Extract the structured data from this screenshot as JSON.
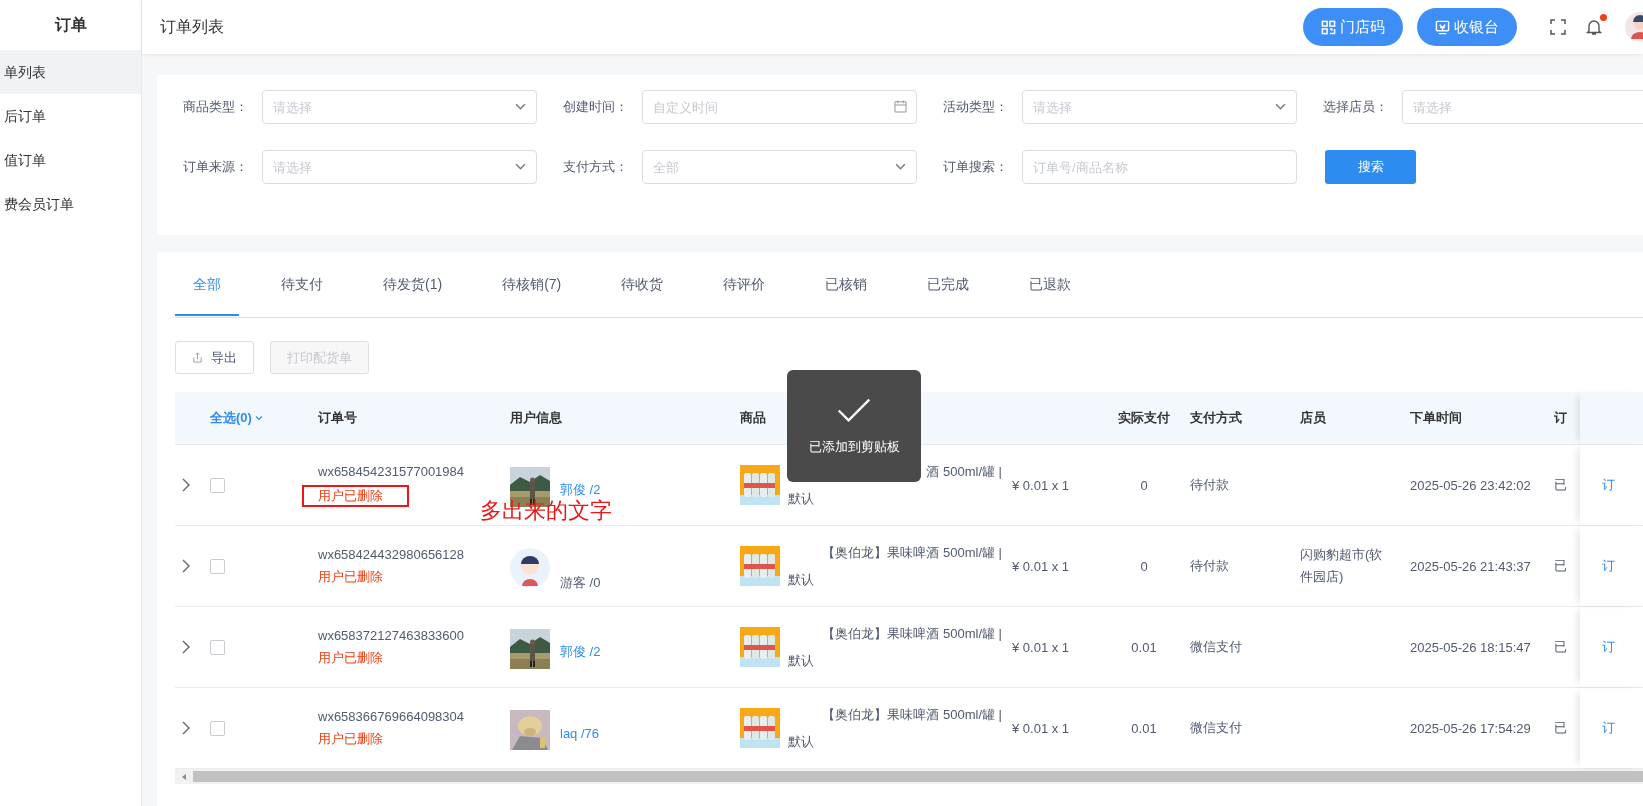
{
  "sidebar": {
    "title": "订单",
    "items": [
      {
        "label": "单列表",
        "selected": true
      },
      {
        "label": "后订单",
        "selected": false
      },
      {
        "label": "值订单",
        "selected": false
      },
      {
        "label": "费会员订单",
        "selected": false
      }
    ]
  },
  "header": {
    "title": "订单列表",
    "buttons": [
      {
        "label": "门店码",
        "kind": "grid"
      },
      {
        "label": "收银台",
        "kind": "cashier"
      }
    ],
    "notification_dot": true
  },
  "filters": [
    {
      "label": "商品类型：",
      "placeholder": "请选择",
      "kind": "select"
    },
    {
      "label": "创建时间：",
      "placeholder": "自定义时间",
      "kind": "date"
    },
    {
      "label": "活动类型：",
      "placeholder": "请选择",
      "kind": "select"
    },
    {
      "label": "选择店员：",
      "placeholder": "请选择",
      "kind": "input"
    },
    {
      "label": "订单来源：",
      "placeholder": "请选择",
      "kind": "select"
    },
    {
      "label": "支付方式：",
      "placeholder": "全部",
      "kind": "select"
    },
    {
      "label": "订单搜索：",
      "placeholder": "订单号/商品名称",
      "kind": "input"
    }
  ],
  "search_button": "搜索",
  "tabs": [
    {
      "label": "全部",
      "selected": true
    },
    {
      "label": "待支付",
      "selected": false
    },
    {
      "label": "待发货(1)",
      "selected": false
    },
    {
      "label": "待核销(7)",
      "selected": false
    },
    {
      "label": "待收货",
      "selected": false
    },
    {
      "label": "待评价",
      "selected": false
    },
    {
      "label": "已核销",
      "selected": false
    },
    {
      "label": "已完成",
      "selected": false
    },
    {
      "label": "已退款",
      "selected": false
    }
  ],
  "actions": [
    {
      "label": "导出",
      "kind": "export",
      "disabled": false
    },
    {
      "label": "打印配货单",
      "kind": "print",
      "disabled": true
    }
  ],
  "table": {
    "select_all": "全选(0)",
    "columns": [
      "订单号",
      "用户信息",
      "商品",
      "",
      "实际支付",
      "支付方式",
      "店员",
      "下单时间",
      "订"
    ],
    "rows": [
      {
        "checked": false,
        "order_no": "wx658454231577001984",
        "note": "用户已删除",
        "annotated": true,
        "user": {
          "name": "郭俊 /2",
          "guest": false
        },
        "product": {
          "name": "酒 500ml/罐 |",
          "spec": "默认"
        },
        "price": "¥ 0.01 x 1",
        "paid": "0",
        "pay_method": "待付款",
        "clerk": "",
        "time": "2025-05-26 23:42:02",
        "status": "已",
        "action": "订"
      },
      {
        "checked": false,
        "order_no": "wx658424432980656128",
        "note": "用户已删除",
        "annotated": false,
        "user": {
          "name": "游客 /0",
          "guest": true,
          "kind": "cartoon"
        },
        "product": {
          "name": "【奥伯龙】果味啤酒 500ml/罐 |",
          "spec": "默认"
        },
        "price": "¥ 0.01 x 1",
        "paid": "0",
        "pay_method": "待付款",
        "clerk": "闪购豹超市(软件园店)",
        "time": "2025-05-26 21:43:37",
        "status": "已",
        "action": "订"
      },
      {
        "checked": false,
        "order_no": "wx658372127463833600",
        "note": "用户已删除",
        "annotated": false,
        "user": {
          "name": "郭俊 /2",
          "guest": false
        },
        "product": {
          "name": "【奥伯龙】果味啤酒 500ml/罐 |",
          "spec": "默认"
        },
        "price": "¥ 0.01 x 1",
        "paid": "0.01",
        "pay_method": "微信支付",
        "clerk": "",
        "time": "2025-05-26 18:15:47",
        "status": "已",
        "action": "订"
      },
      {
        "checked": false,
        "order_no": "wx658366769664098304",
        "note": "用户已删除",
        "annotated": false,
        "user": {
          "name": "laq /76",
          "guest": false,
          "kind": "drawing"
        },
        "product": {
          "name": "【奥伯龙】果味啤酒 500ml/罐 |",
          "spec": "默认"
        },
        "price": "¥ 0.01 x 1",
        "paid": "0.01",
        "pay_method": "微信支付",
        "clerk": "",
        "time": "2025-05-26 17:54:29",
        "status": "已",
        "action": "订"
      }
    ]
  },
  "annotation": "多出来的文字",
  "toast": "已添加到剪贴板"
}
